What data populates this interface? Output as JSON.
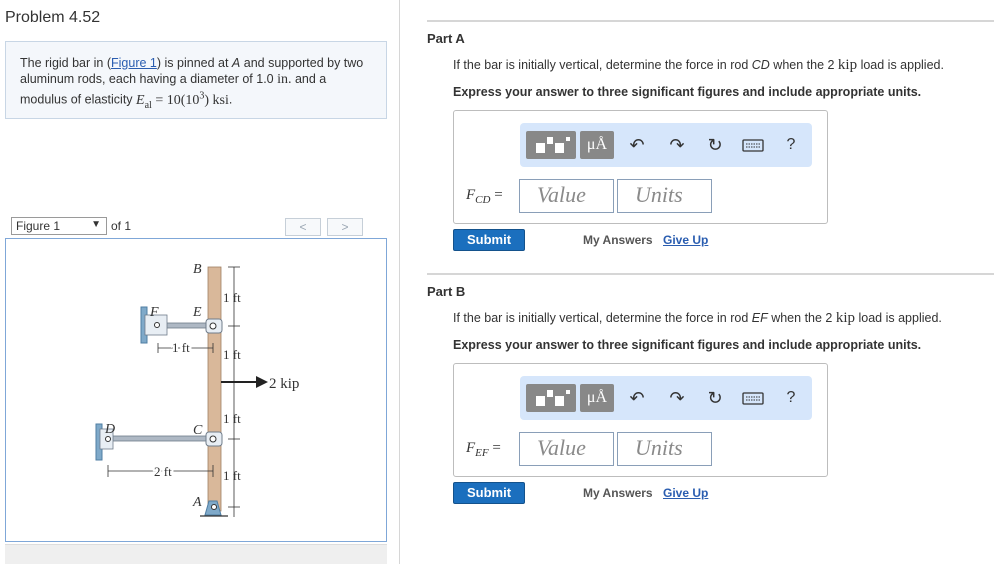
{
  "problem": {
    "title": "Problem 4.52",
    "statement": {
      "t1": "The rigid bar in (",
      "link": "Figure 1",
      "t2": ") is pinned at ",
      "pinA": "A",
      "t3": " and supported by two aluminum rods, each having a diameter of 1.0 ",
      "unit_in": "in.",
      "t4": " and a modulus of elasticity ",
      "math_E": "E",
      "math_E_sub": "al",
      "math_eq": " = 10(10",
      "math_exp": "3",
      "math_close": ")",
      "unit_ksi": " ksi",
      "t5": "."
    }
  },
  "figure_nav": {
    "selected": "Figure 1",
    "of": "of 1",
    "prev": "<",
    "next": ">"
  },
  "figure": {
    "labels": {
      "B": "B",
      "E": "E",
      "F": "F",
      "C": "C",
      "D": "D",
      "A": "A",
      "d1": "1 ft",
      "d2": "1 ft",
      "d3": "1 ft",
      "d4": "1 ft",
      "ef_len": "1 ft",
      "cd_len": "2 ft",
      "load": "2 kip"
    },
    "colors": {
      "bar": "#d9b89a",
      "rod": "#aeb8c4",
      "support": "#7fa9c9"
    }
  },
  "partA": {
    "title": "Part A",
    "q1": "If the bar is initially vertical, determine the force in rod ",
    "rod": "CD",
    "q2": " when the 2 ",
    "kip": "kip",
    "q3": " load is applied.",
    "instruction": "Express your answer to three significant figures and include appropriate units.",
    "label_main": "F",
    "label_sub": "CD",
    "label_eq": " =",
    "value_placeholder": "Value",
    "units_placeholder": "Units",
    "submit": "Submit",
    "my_answers": "My Answers",
    "give_up": "Give Up"
  },
  "partB": {
    "title": "Part B",
    "q1": "If the bar is initially vertical, determine the force in rod ",
    "rod": "EF",
    "q2": " when the 2 ",
    "kip": "kip",
    "q3": " load is applied.",
    "instruction": "Express your answer to three significant figures and include appropriate units.",
    "label_main": "F",
    "label_sub": "EF",
    "label_eq": " =",
    "value_placeholder": "Value",
    "units_placeholder": "Units",
    "submit": "Submit",
    "my_answers": "My Answers",
    "give_up": "Give Up"
  },
  "toolbar": {
    "mu_label": "μÅ",
    "help": "?",
    "icons": [
      "templates-icon",
      "units-icon",
      "undo-icon",
      "redo-icon",
      "reset-icon",
      "keyboard-icon",
      "help-icon"
    ]
  }
}
